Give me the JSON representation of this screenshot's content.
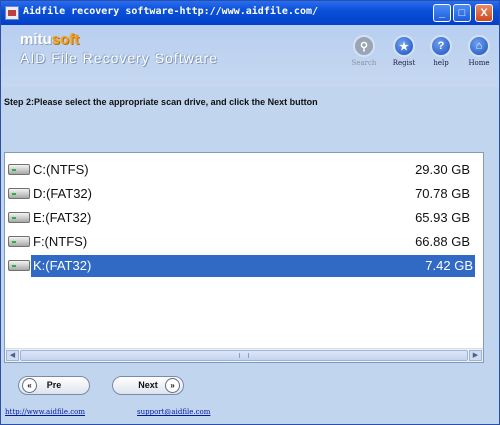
{
  "window": {
    "title": "Aidfile recovery software-http://www.aidfile.com/",
    "buttons": [
      "_",
      "□",
      "X"
    ]
  },
  "brand": {
    "logo_part1": "mitu",
    "logo_part2": "soft",
    "product": "AID File Recovery Software"
  },
  "toolbar": {
    "search": "Search",
    "regist": "Regist",
    "help": "help",
    "home": "Home"
  },
  "step_text": "Step 2:Please select the appropriate scan drive, and click the Next button",
  "drives": [
    {
      "name": "C:(NTFS)",
      "size": "29.30 GB",
      "selected": false
    },
    {
      "name": "D:(FAT32)",
      "size": "70.78 GB",
      "selected": false
    },
    {
      "name": "E:(FAT32)",
      "size": "65.93 GB",
      "selected": false
    },
    {
      "name": "F:(NTFS)",
      "size": "66.88 GB",
      "selected": false
    },
    {
      "name": "K:(FAT32)",
      "size": "7.42 GB",
      "selected": true
    }
  ],
  "nav": {
    "prev": "Pre",
    "prev_icon": "«",
    "next": "Next",
    "next_icon": "»"
  },
  "footer": {
    "website": "http://www.aidfile.com",
    "email": "support@aidfile.com"
  },
  "colors": {
    "selection": "#316ac5",
    "titlebar": "#0a4fd8",
    "logo_accent": "#f4a020"
  }
}
